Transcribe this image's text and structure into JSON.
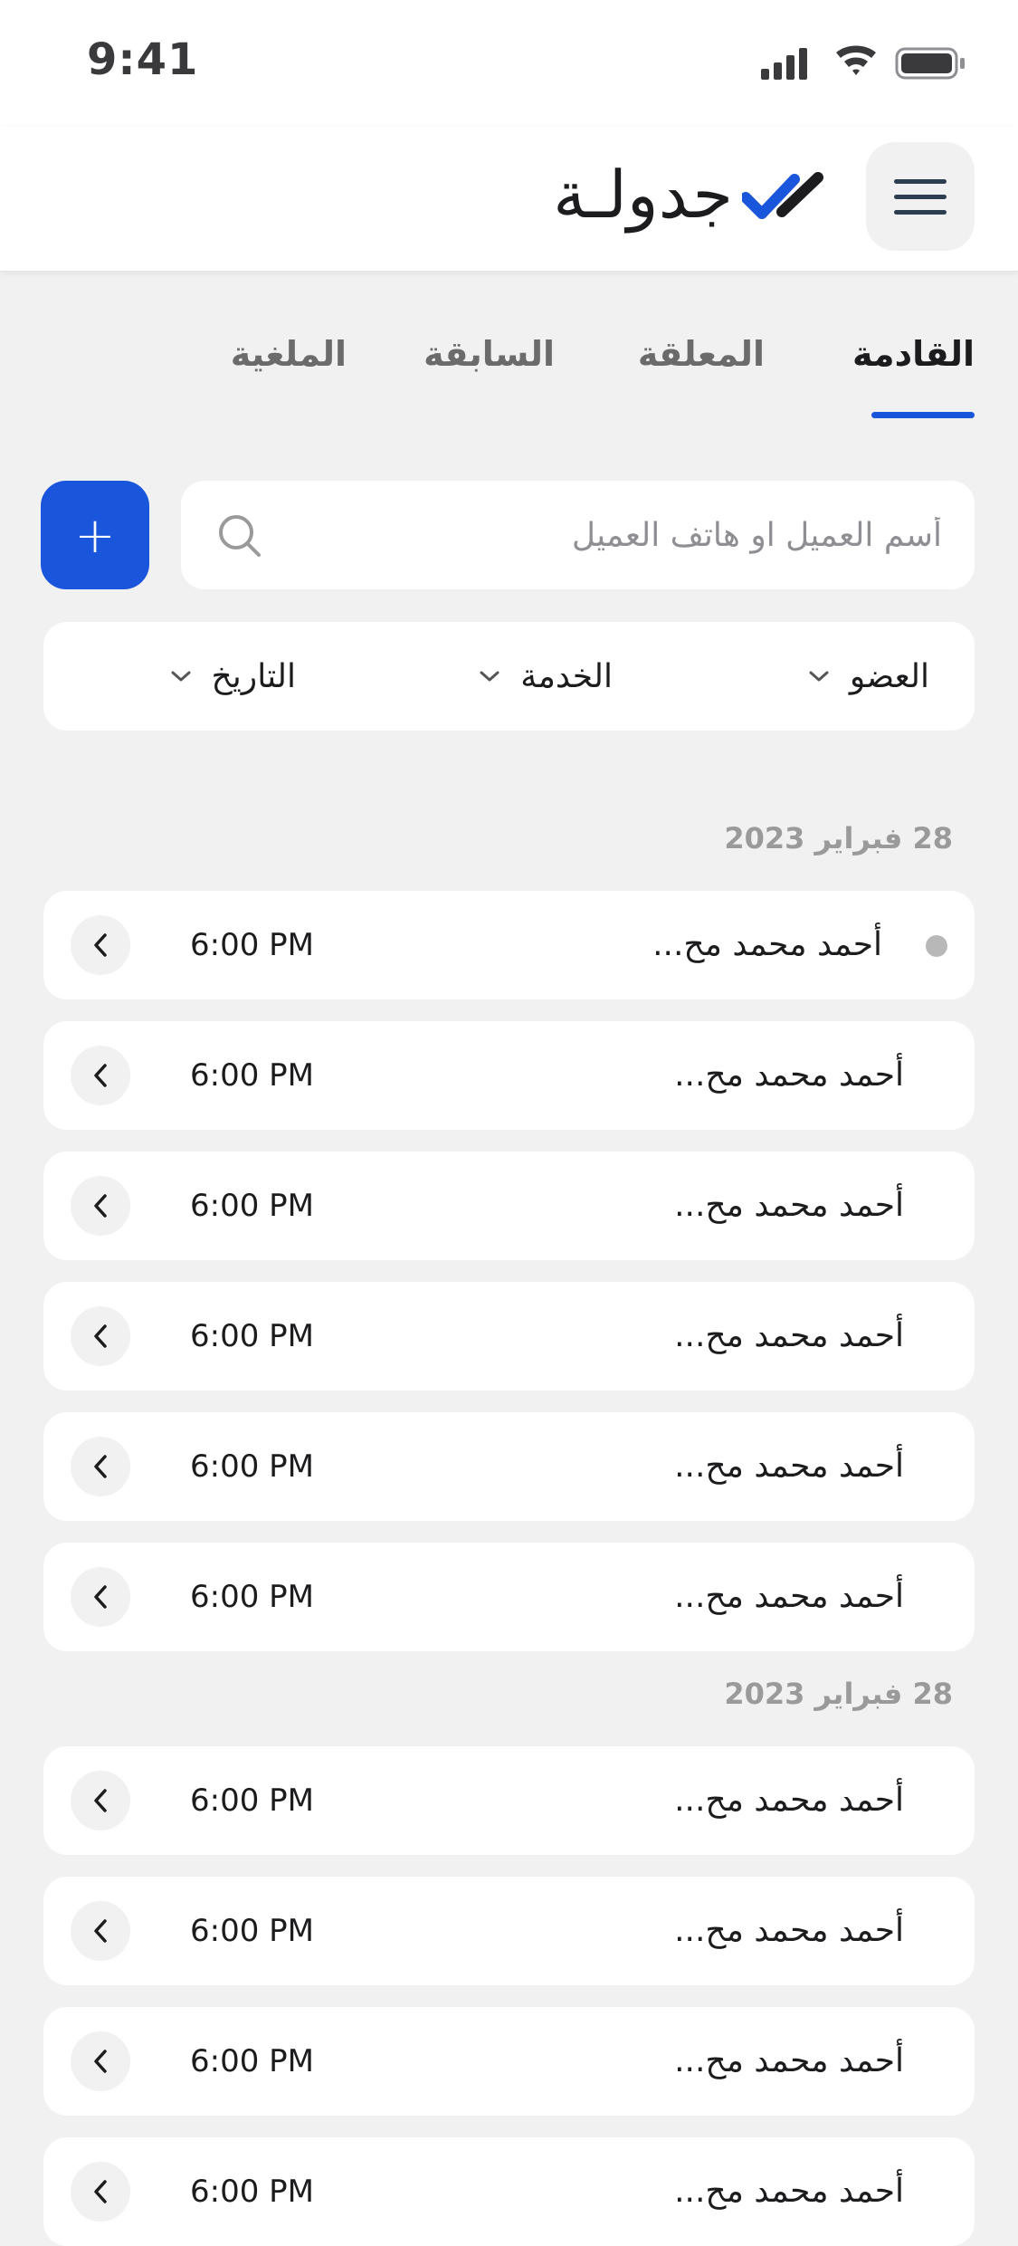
{
  "status_bar": {
    "time": "9:41"
  },
  "header": {
    "logo_text": "جدولـة",
    "brand_color": "#1a56db"
  },
  "tabs": [
    {
      "label": "القادمة",
      "active": true
    },
    {
      "label": "المعلقة",
      "active": false
    },
    {
      "label": "السابقة",
      "active": false
    },
    {
      "label": "الملغية",
      "active": false
    }
  ],
  "search": {
    "placeholder": "أسم العميل او هاتف العميل",
    "add_label": "+"
  },
  "filters": [
    {
      "label": "العضو"
    },
    {
      "label": "الخدمة"
    },
    {
      "label": "التاريخ"
    }
  ],
  "groups": [
    {
      "date": "28 فبراير 2023",
      "appointments": [
        {
          "name": "أحمد محمد مح...",
          "time": "6:00 PM",
          "status_dot": true
        },
        {
          "name": "أحمد محمد مح...",
          "time": "6:00 PM",
          "status_dot": false
        },
        {
          "name": "أحمد محمد مح...",
          "time": "6:00 PM",
          "status_dot": false
        },
        {
          "name": "أحمد محمد مح...",
          "time": "6:00 PM",
          "status_dot": false
        },
        {
          "name": "أحمد محمد مح...",
          "time": "6:00 PM",
          "status_dot": false
        },
        {
          "name": "أحمد محمد مح...",
          "time": "6:00 PM",
          "status_dot": false
        }
      ]
    },
    {
      "date": "28 فبراير 2023",
      "appointments": [
        {
          "name": "أحمد محمد مح...",
          "time": "6:00 PM",
          "status_dot": false
        },
        {
          "name": "أحمد محمد مح...",
          "time": "6:00 PM",
          "status_dot": false
        },
        {
          "name": "أحمد محمد مح...",
          "time": "6:00 PM",
          "status_dot": false
        },
        {
          "name": "أحمد محمد مح...",
          "time": "6:00 PM",
          "status_dot": false
        }
      ]
    }
  ]
}
